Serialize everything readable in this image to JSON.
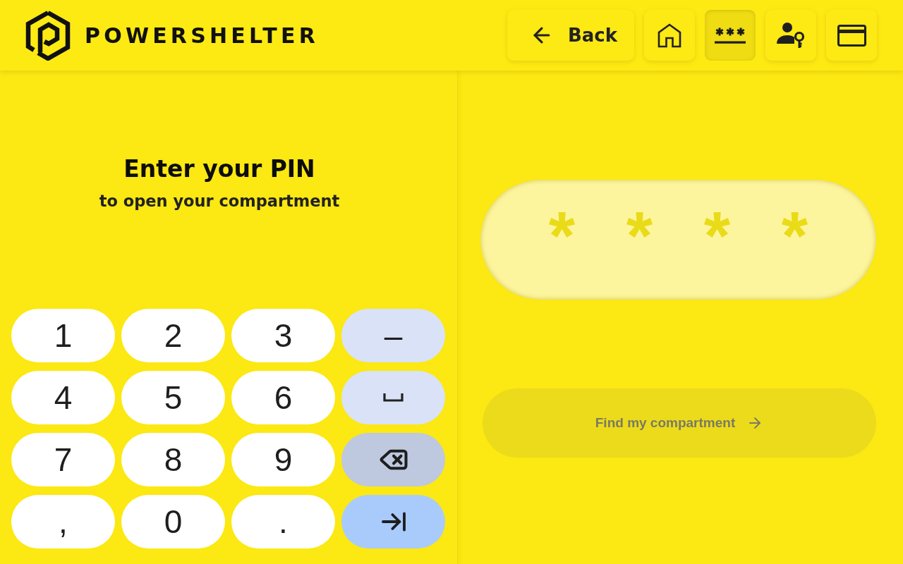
{
  "header": {
    "brand": "POWERSHELTER",
    "nav": [
      {
        "kind": "back",
        "label": "Back",
        "selected": false
      },
      {
        "kind": "home",
        "selected": false
      },
      {
        "kind": "pin",
        "selected": true
      },
      {
        "kind": "user-key",
        "selected": false
      },
      {
        "kind": "card",
        "selected": false
      }
    ]
  },
  "prompt": {
    "title": "Enter your PIN",
    "subtitle": "to open your compartment"
  },
  "keypad": {
    "keys": [
      {
        "kind": "char",
        "label": "1"
      },
      {
        "kind": "char",
        "label": "2"
      },
      {
        "kind": "char",
        "label": "3"
      },
      {
        "kind": "dash",
        "label": "–"
      },
      {
        "kind": "char",
        "label": "4"
      },
      {
        "kind": "char",
        "label": "5"
      },
      {
        "kind": "char",
        "label": "6"
      },
      {
        "kind": "space"
      },
      {
        "kind": "char",
        "label": "7"
      },
      {
        "kind": "char",
        "label": "8"
      },
      {
        "kind": "char",
        "label": "9"
      },
      {
        "kind": "backspace"
      },
      {
        "kind": "char",
        "label": ","
      },
      {
        "kind": "char",
        "label": "0"
      },
      {
        "kind": "char",
        "label": "."
      },
      {
        "kind": "tab"
      }
    ]
  },
  "pin_field": {
    "masked": [
      "*",
      "*",
      "*",
      "*"
    ]
  },
  "find_button": {
    "label": "Find my compartment",
    "disabled": true
  }
}
